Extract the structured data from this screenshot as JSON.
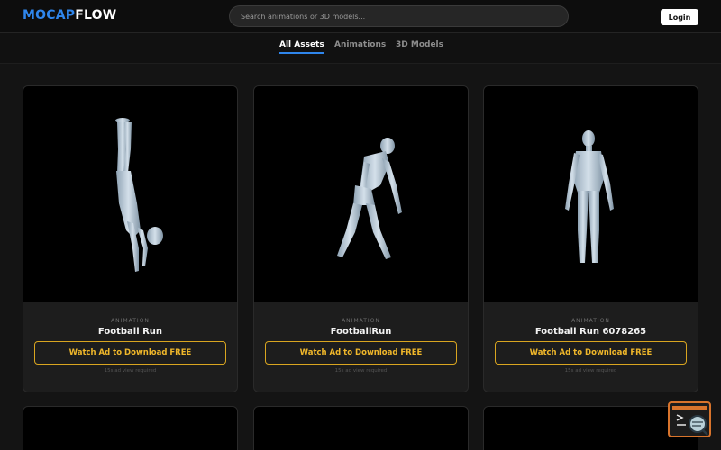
{
  "header": {
    "logo_part1": "MOCAP",
    "logo_part2": "FLOW",
    "search_placeholder": "Search animations or 3D models...",
    "login_label": "Login"
  },
  "tabs": [
    {
      "label": "All Assets",
      "active": true
    },
    {
      "label": "Animations",
      "active": false
    },
    {
      "label": "3D Models",
      "active": false
    }
  ],
  "cards": [
    {
      "type": "ANIMATION",
      "title": "Football Run",
      "button": "Watch Ad to Download FREE",
      "note": "15s ad view required",
      "pose": "handstand"
    },
    {
      "type": "ANIMATION",
      "title": "FootballRun",
      "button": "Watch Ad to Download FREE",
      "note": "15s ad view required",
      "pose": "bent-over"
    },
    {
      "type": "ANIMATION",
      "title": "Football Run 6078265",
      "button": "Watch Ad to Download FREE",
      "note": "15s ad view required",
      "pose": "standing"
    }
  ],
  "colors": {
    "accent": "#2f86ec",
    "download_border": "#d9a520",
    "download_text": "#f0b72a",
    "fab_border": "#d8742c"
  },
  "icons": {
    "floating_button": "terminal-search-icon"
  }
}
